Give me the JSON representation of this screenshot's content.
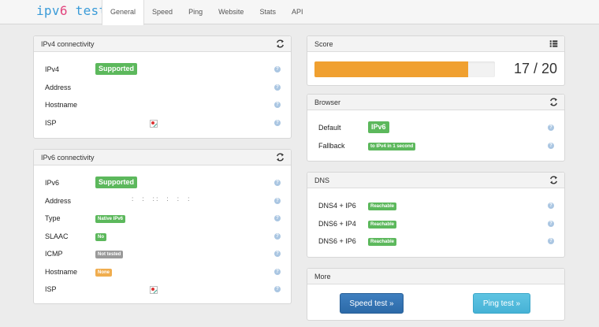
{
  "logo": {
    "part1": "ipv",
    "part2": "6",
    "part3": " test"
  },
  "nav": [
    {
      "label": "General",
      "active": true
    },
    {
      "label": "Speed"
    },
    {
      "label": "Ping"
    },
    {
      "label": "Website"
    },
    {
      "label": "Stats"
    },
    {
      "label": "API"
    }
  ],
  "ipv4": {
    "title": "IPv4 connectivity",
    "rows": {
      "ipv4": {
        "label": "IPv4",
        "value": "Supported"
      },
      "address": {
        "label": "Address"
      },
      "hostname": {
        "label": "Hostname"
      },
      "isp": {
        "label": "ISP"
      }
    }
  },
  "ipv6": {
    "title": "IPv6 connectivity",
    "rows": {
      "ipv6": {
        "label": "IPv6",
        "value": "Supported"
      },
      "address": {
        "label": "Address",
        "value": ":     :     : :     :     :     :"
      },
      "type": {
        "label": "Type",
        "value": "Native IPv6"
      },
      "slaac": {
        "label": "SLAAC",
        "value": "No"
      },
      "icmp": {
        "label": "ICMP",
        "value": "Not tested"
      },
      "hostname": {
        "label": "Hostname",
        "value": "None"
      },
      "isp": {
        "label": "ISP"
      }
    }
  },
  "score": {
    "title": "Score",
    "text": "17 / 20",
    "fraction": 0.85
  },
  "browser": {
    "title": "Browser",
    "rows": {
      "default": {
        "label": "Default",
        "value": "IPv6"
      },
      "fallback": {
        "label": "Fallback",
        "value": "to IPv4 in 1 second"
      }
    }
  },
  "dns": {
    "title": "DNS",
    "rows": {
      "dns4ip6": {
        "label": "DNS4 + IP6",
        "value": "Reachable"
      },
      "dns6ip4": {
        "label": "DNS6 + IP4",
        "value": "Reachable"
      },
      "dns6ip6": {
        "label": "DNS6 + IP6",
        "value": "Reachable"
      }
    }
  },
  "more": {
    "title": "More",
    "speed_button": "Speed test »",
    "ping_button": "Ping test »"
  },
  "colors": {
    "green": "#5cb85c",
    "gray": "#9a9a9a",
    "orange": "#f0ad4e",
    "progress": "#f0a030",
    "help": "#aac6e2"
  },
  "icons": {
    "refresh": "refresh-icon",
    "list": "list-icon",
    "help": "question-icon",
    "broken": "broken-image-icon"
  }
}
